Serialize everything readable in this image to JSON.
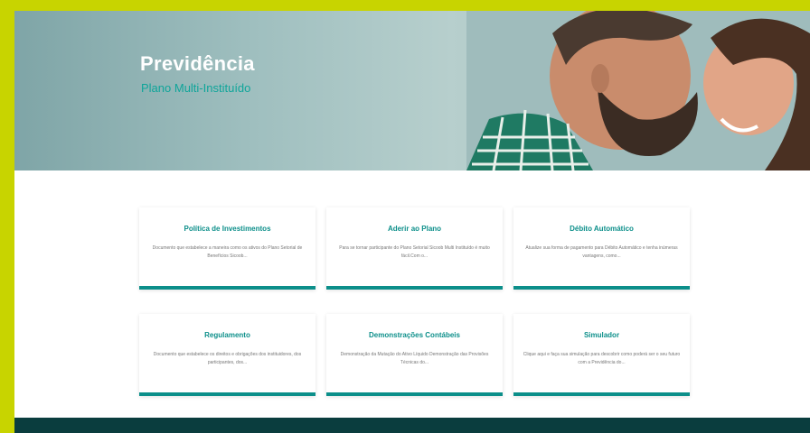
{
  "hero": {
    "title": "Previdência",
    "subtitle": "Plano Multi-Instituído"
  },
  "cards": [
    {
      "title": "Política de Investimentos",
      "description": "Documento que estabelece a maneira como os ativos do Plano Setorial de Benefícios Sicoob..."
    },
    {
      "title": "Aderir ao Plano",
      "description": "Para se tornar participante do Plano Setorial Sicoob Multi Instituído é muito fácil.Com o..."
    },
    {
      "title": "Débito Automático",
      "description": "Atualize sua forma de pagamento para Débito Automático e tenha inúmeras vantagens, como..."
    },
    {
      "title": "Regulamento",
      "description": "Documento que estabelece os direitos e obrigações dos instituidores, dos participantes, dos..."
    },
    {
      "title": "Demonstrações Contábeis",
      "description": "Demonstração da Mutação do Ativo Líquido Demonstração das Provisões Técnicas do..."
    },
    {
      "title": "Simulador",
      "description": "Clique aqui e faça sua simulação para descobrir como poderá ser o seu futuro com a Previdência do..."
    }
  ],
  "colors": {
    "accent": "#0c8f8a",
    "frame": "#c8d400",
    "footer": "#0a3d3e"
  }
}
